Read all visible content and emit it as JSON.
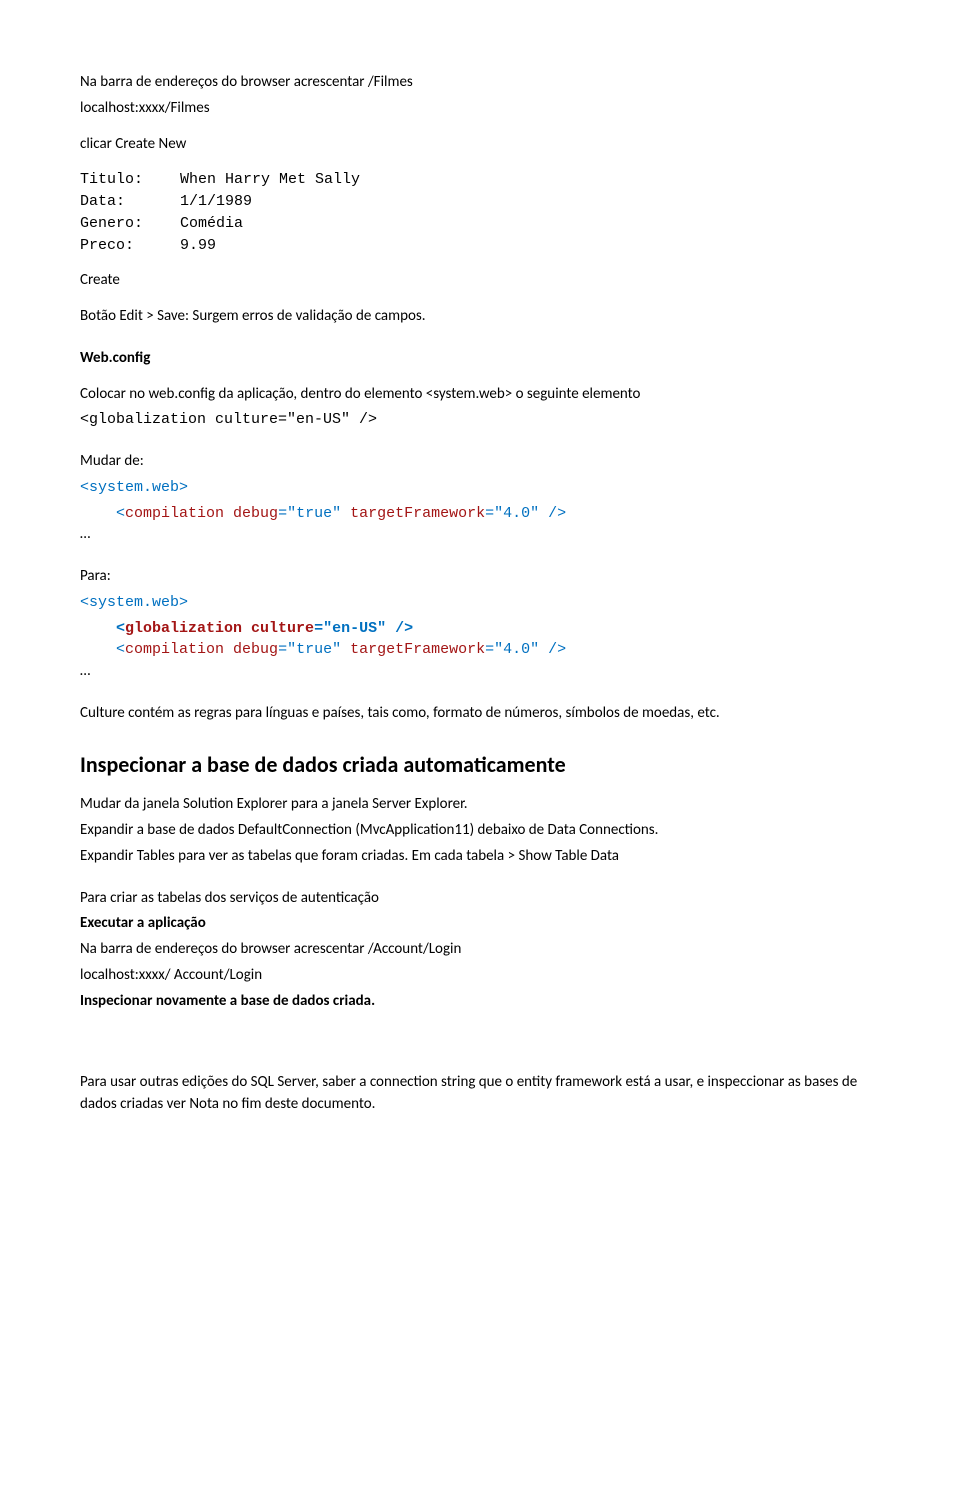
{
  "intro": {
    "l1": "Na barra de endereços do browser acrescentar /Filmes",
    "l2": "localhost:xxxx/Filmes"
  },
  "click": "clicar  Create New",
  "form": {
    "titulo_l": "Titulo:",
    "titulo_v": "When Harry Met Sally",
    "data_l": "Data:",
    "data_v": "1/1/1989",
    "genero_l": "Genero:",
    "genero_v": "Comédia",
    "preco_l": "Preco:",
    "preco_v": "9.99"
  },
  "create": "Create",
  "edit_note": "Botão Edit  >  Save:   Surgem erros de validação de campos.",
  "webconfig": {
    "title": "Web.config",
    "l1": "Colocar no web.config da aplicação, dentro do elemento  <system.web> o seguinte elemento",
    "l2": "<globalization culture=\"en-US\" />"
  },
  "mudar": {
    "label": "Mudar de:",
    "open": "<system.web>",
    "comp_tag": "<",
    "comp_name": "compilation",
    "comp_attr1": " debug",
    "comp_eq1": "=\"",
    "comp_val1": "true",
    "comp_sep1": "\"",
    "comp_attr2": " targetFramework",
    "comp_eq2": "=\"",
    "comp_val2": "4.0",
    "comp_end": "\" />",
    "ellipsis": "…"
  },
  "para": {
    "label": "Para:",
    "open": "<system.web>",
    "glob_tag": "<",
    "glob_name": "globalization",
    "glob_attr": " culture",
    "glob_eq": "=\"",
    "glob_val": "en-US",
    "glob_end": "\" />",
    "comp_tag": "<",
    "comp_name": "compilation",
    "comp_attr1": " debug",
    "comp_eq1": "=\"",
    "comp_val1": "true",
    "comp_sep1": "\"",
    "comp_attr2": " targetFramework",
    "comp_eq2": "=\"",
    "comp_val2": "4.0",
    "comp_end": "\" />",
    "ellipsis": "…"
  },
  "culture_note": "Culture contém as regras para línguas e países, tais como, formato de números, símbolos de moedas, etc.",
  "inspecionar": {
    "title": "Inspecionar a base de dados criada automaticamente",
    "p1": "Mudar da janela Solution Explorer para a janela Server Explorer.",
    "p2": "Expandir a base de dados   DefaultConnection (MvcApplication11) debaixo de Data Connections.",
    "p3": "Expandir Tables para ver as tabelas que foram criadas. Em cada tabela > Show Table Data",
    "p4": "Para criar as tabelas dos serviços de autenticação",
    "p5": "Executar a aplicação",
    "p6": "Na barra de endereços do browser acrescentar /Account/Login",
    "p7": "localhost:xxxx/ Account/Login",
    "p8": "Inspecionar novamente a base de dados criada."
  },
  "final": "Para usar outras edições do SQL Server, saber a connection string que o entity framework está a usar, e inspeccionar as bases de dados criadas ver Nota no fim deste documento."
}
